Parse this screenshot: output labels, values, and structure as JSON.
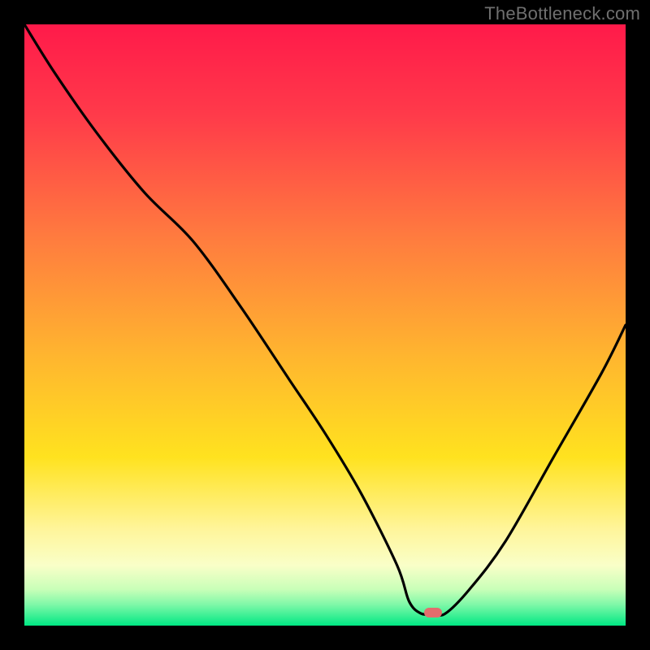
{
  "attribution": "TheBottleneck.com",
  "gradient": {
    "stops": [
      {
        "offset": 0.0,
        "color": "#ff1a4a"
      },
      {
        "offset": 0.15,
        "color": "#ff3a4a"
      },
      {
        "offset": 0.35,
        "color": "#ff7a3f"
      },
      {
        "offset": 0.55,
        "color": "#ffb52f"
      },
      {
        "offset": 0.72,
        "color": "#ffe21f"
      },
      {
        "offset": 0.84,
        "color": "#fff59b"
      },
      {
        "offset": 0.9,
        "color": "#f9ffc8"
      },
      {
        "offset": 0.94,
        "color": "#c8ffb8"
      },
      {
        "offset": 0.965,
        "color": "#7ff8a8"
      },
      {
        "offset": 1.0,
        "color": "#00e884"
      }
    ]
  },
  "marker": {
    "x_frac": 0.68,
    "y_frac": 0.978,
    "color": "#e36d6d"
  },
  "chart_data": {
    "type": "line",
    "title": "",
    "xlabel": "",
    "ylabel": "",
    "xlim": [
      0,
      100
    ],
    "ylim": [
      0,
      100
    ],
    "series": [
      {
        "name": "bottleneck-curve",
        "x": [
          0,
          5,
          12,
          20,
          28,
          36,
          44,
          50,
          56,
          62,
          64,
          66,
          68,
          70,
          74,
          80,
          88,
          96,
          100
        ],
        "y": [
          100,
          92,
          82,
          72,
          64,
          53,
          41,
          32,
          22,
          10,
          4,
          2,
          2,
          2,
          6,
          14,
          28,
          42,
          50
        ]
      }
    ],
    "optimum_x": 68
  }
}
